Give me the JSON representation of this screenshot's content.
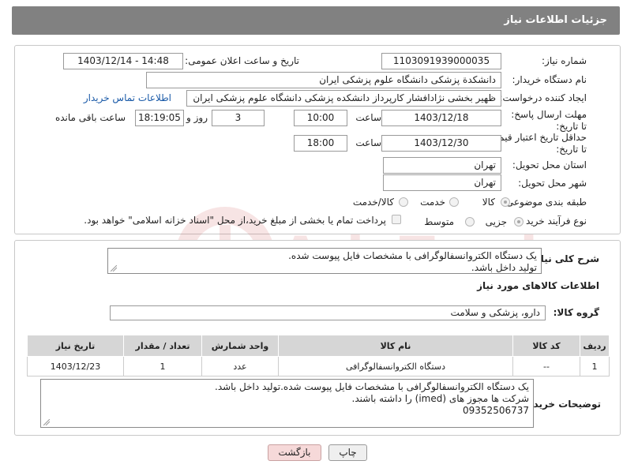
{
  "header": {
    "title": "جزئیات اطلاعات نیاز"
  },
  "form": {
    "need_number_label": "شماره نیاز:",
    "need_number": "1103091939000035",
    "announce_label": "تاریخ و ساعت اعلان عمومی:",
    "announce_value": "1403/12/14 - 14:48",
    "buyer_org_label": "نام دستگاه خریدار:",
    "buyer_org": "دانشکدة پزشکی دانشگاه علوم پزشکی ایران",
    "creator_label": "ایجاد کننده درخواست:",
    "creator": "ظهیر بخشی نژادافشار کارپرداز دانشکده پزشکی دانشگاه علوم پزشکی ایران",
    "contact_link": "اطلاعات تماس خریدار",
    "deadline_label": "مهلت ارسال پاسخ: تا تاریخ:",
    "deadline_date": "1403/12/18",
    "time_label": "ساعت",
    "deadline_time": "10:00",
    "days_value": "3",
    "days_label": "روز و",
    "remaining_time": "18:19:05",
    "remaining_label": "ساعت باقی مانده",
    "validity_label": "حداقل تاریخ اعتبار قیمت: تا تاریخ:",
    "validity_date": "1403/12/30",
    "validity_time": "18:00",
    "province_label": "استان محل تحویل:",
    "province": "تهران",
    "city_label": "شهر محل تحویل:",
    "city": "تهران",
    "category_label": "طبقه بندی موضوعی:",
    "category_options": [
      "کالا",
      "خدمت",
      "کالا/خدمت"
    ],
    "category_selected": "کالا",
    "process_label": "نوع فرآیند خرید :",
    "process_options": [
      "جزیی",
      "متوسط"
    ],
    "process_selected": "جزیی",
    "payment_text": "پرداخت تمام یا بخشی از مبلغ خرید،از محل \"اسناد خزانه اسلامی\" خواهد بود."
  },
  "details": {
    "description_label": "شرح کلی نیاز:",
    "description_lines": [
      "یک دستگاه الکتروانسفالوگرافی با مشخصات فایل پیوست شده.",
      "تولید داخل باشد."
    ],
    "goods_info_title": "اطلاعات کالاهای مورد نیاز",
    "goods_group_label": "گروه کالا:",
    "goods_group": "دارو، پزشکی و سلامت",
    "table_headers": [
      "ردیف",
      "کد کالا",
      "نام کالا",
      "واحد شمارش",
      "تعداد / مقدار",
      "تاریخ نیاز"
    ],
    "table_rows": [
      [
        "1",
        "--",
        "دستگاه الکتروانسفالوگرافی",
        "عدد",
        "1",
        "1403/12/23"
      ]
    ],
    "buyer_notes_label": "توضیحات خریدار:",
    "buyer_notes_lines": [
      "یک دستگاه الکتروانسفالوگرافی با مشخصات فایل پیوست شده.تولید داخل باشد.",
      "شرکت ها مجوز های (imed) را داشته باشند.",
      "09352506737"
    ]
  },
  "buttons": {
    "print": "چاپ",
    "back": "بازگشت"
  },
  "watermark": {
    "text": "AriaTender.neT"
  },
  "colors": {
    "header_bg": "#818181",
    "link": "#1a5aa8",
    "back_button_bg": "#f6d9d9"
  }
}
